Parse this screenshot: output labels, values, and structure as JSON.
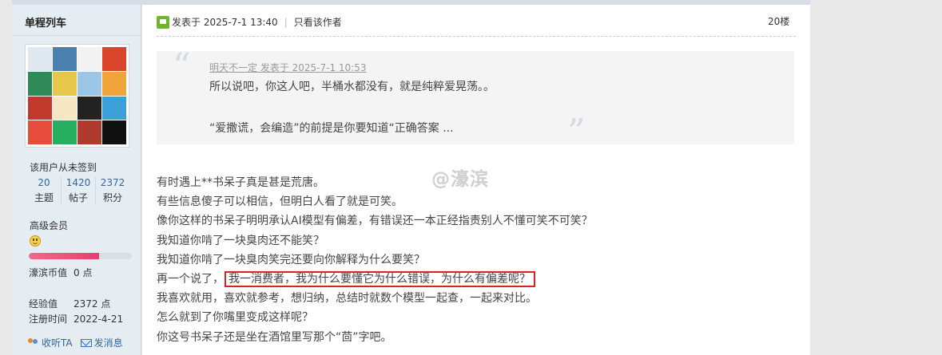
{
  "sidebar": {
    "username": "单程列车",
    "signin_status": "该用户从未签到",
    "stats": [
      {
        "value": "20",
        "label": "主题"
      },
      {
        "value": "1420",
        "label": "帖子"
      },
      {
        "value": "2372",
        "label": "积分"
      }
    ],
    "rank": "高级会员",
    "level_progress_percent": 68,
    "currency_label": "濠滨币值",
    "currency_value": "0 点",
    "exp_label": "经验值",
    "exp_value": "2372 点",
    "reg_label": "注册时间",
    "reg_value": "2022-4-21",
    "follow_label": "收听TA",
    "message_label": "发消息"
  },
  "post": {
    "posted_at": "发表于 2025-7-1 13:40",
    "author_only": "只看该作者",
    "floor": "20楼",
    "quote": {
      "author_line": "明天不一定 发表于 2025-7-1 10:53",
      "line1": "所以说吧，你这人吧，半桶水都没有，就是纯粹爱晃荡。。",
      "line2": "“爱撒谎，会编造”的前提是你要知道“正确答案 ..."
    },
    "watermark": "@濠滨",
    "lines": [
      "有时遇上**书呆子真是甚是荒唐。",
      "有些信息傻子可以相信，但明白人看了就是可笑。",
      "像你这样的书呆子明明承认AI模型有偏差，有错误还一本正经指责别人不懂可笑不可笑？",
      "我知道你啃了一块臭肉还不能笑？",
      "我知道你啃了一块臭肉笑完还要向你解释为什么要笑？"
    ],
    "line6_prefix": "再一个说了，",
    "line6_highlight": "我一消费者，我为什么要懂它为什么错误，为什么有偏差呢？",
    "lines_after": [
      "我喜欢就用，喜欢就参考，想归纳，总结时就数个模型一起查，一起来对比。",
      "怎么就到了你嘴里变成这样呢？",
      "你这号书呆子还是坐在酒馆里写那个“茴”字吧。"
    ]
  },
  "colors": {
    "sidebar_bg": "#e5edf2",
    "link": "#336699",
    "highlight_border": "#dd2222",
    "progress": "#e3416b"
  }
}
